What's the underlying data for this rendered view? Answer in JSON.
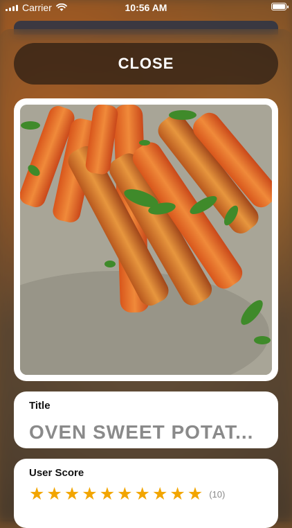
{
  "status_bar": {
    "carrier": "Carrier",
    "time": "10:56 AM",
    "battery_level": 1.0
  },
  "close_button": {
    "label": "CLOSE"
  },
  "photo": {
    "subject": "roasted carrot fries with parsley on a plate"
  },
  "title_card": {
    "label": "Title",
    "value": "OVEN SWEET POTAT..."
  },
  "score_card": {
    "label": "User Score",
    "stars_filled": 10,
    "stars_total": 10,
    "count_text": "(10)"
  },
  "colors": {
    "star": "#f2a500",
    "close_bg": "#281c14"
  }
}
